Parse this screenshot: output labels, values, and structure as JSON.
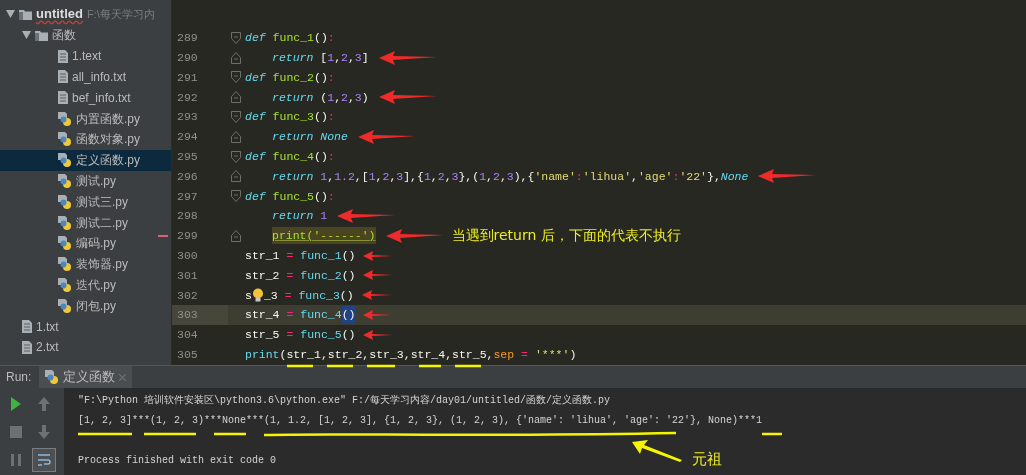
{
  "project_tree": {
    "name": "untitled",
    "path": "F:\\每天学习内",
    "expanded": true,
    "selected": false,
    "children": [
      {
        "name": "函数",
        "kind": "folder",
        "expanded": true,
        "selected": false,
        "children": [
          {
            "name": "1.text",
            "kind": "text",
            "selected": false
          },
          {
            "name": "all_info.txt",
            "kind": "text",
            "selected": false
          },
          {
            "name": "bef_info.txt",
            "kind": "text",
            "selected": false
          },
          {
            "name": "内置函数.py",
            "kind": "python",
            "selected": false
          },
          {
            "name": "函数对象.py",
            "kind": "python",
            "selected": false
          },
          {
            "name": "定义函数.py",
            "kind": "python",
            "selected": true
          },
          {
            "name": "测试.py",
            "kind": "python",
            "selected": false
          },
          {
            "name": "测试三.py",
            "kind": "python",
            "selected": false
          },
          {
            "name": "测试二.py",
            "kind": "python",
            "selected": false
          },
          {
            "name": "编码.py",
            "kind": "python",
            "selected": false
          },
          {
            "name": "装饰器.py",
            "kind": "python",
            "selected": false
          },
          {
            "name": "迭代.py",
            "kind": "python",
            "selected": false
          },
          {
            "name": "闭包.py",
            "kind": "python",
            "selected": false
          }
        ]
      },
      {
        "name": "1.txt",
        "kind": "text",
        "selected": false
      },
      {
        "name": "2.txt",
        "kind": "text",
        "selected": false
      }
    ]
  },
  "editor": {
    "lines": [
      {
        "number": "289",
        "fold": {
          "kind": "start"
        },
        "indented": false,
        "current": false,
        "tokens": [
          {
            "text": "def ",
            "kind": "kw"
          },
          {
            "text": "func_1",
            "kind": "fn"
          },
          {
            "text": "()",
            "kind": "p"
          },
          {
            "text": ":",
            "kind": "op"
          }
        ]
      },
      {
        "number": "290",
        "fold": {
          "kind": "end"
        },
        "indented": true,
        "arrow": {
          "kind": "large"
        },
        "current": false,
        "tokens": [
          {
            "text": "return ",
            "kind": "kw"
          },
          {
            "text": "[",
            "kind": "p"
          },
          {
            "text": "1",
            "kind": "num"
          },
          {
            "text": ",",
            "kind": "p"
          },
          {
            "text": "2",
            "kind": "num"
          },
          {
            "text": ",",
            "kind": "p"
          },
          {
            "text": "3",
            "kind": "num"
          },
          {
            "text": "]",
            "kind": "p"
          }
        ]
      },
      {
        "number": "291",
        "fold": {
          "kind": "start"
        },
        "indented": false,
        "current": false,
        "tokens": [
          {
            "text": "def ",
            "kind": "kw"
          },
          {
            "text": "func_2",
            "kind": "fn"
          },
          {
            "text": "()",
            "kind": "p"
          },
          {
            "text": ":",
            "kind": "op"
          }
        ]
      },
      {
        "number": "292",
        "fold": {
          "kind": "end"
        },
        "indented": true,
        "arrow": {
          "kind": "large"
        },
        "current": false,
        "tokens": [
          {
            "text": "return ",
            "kind": "kw"
          },
          {
            "text": "(",
            "kind": "p"
          },
          {
            "text": "1",
            "kind": "num"
          },
          {
            "text": ",",
            "kind": "p"
          },
          {
            "text": "2",
            "kind": "num"
          },
          {
            "text": ",",
            "kind": "p"
          },
          {
            "text": "3",
            "kind": "num"
          },
          {
            "text": ")",
            "kind": "p"
          }
        ]
      },
      {
        "number": "293",
        "fold": {
          "kind": "start"
        },
        "indented": false,
        "current": false,
        "tokens": [
          {
            "text": "def ",
            "kind": "kw"
          },
          {
            "text": "func_3",
            "kind": "fn"
          },
          {
            "text": "()",
            "kind": "p"
          },
          {
            "text": ":",
            "kind": "op"
          }
        ]
      },
      {
        "number": "294",
        "fold": {
          "kind": "end"
        },
        "indented": true,
        "arrow": {
          "kind": "large"
        },
        "current": false,
        "tokens": [
          {
            "text": "return ",
            "kind": "kw"
          },
          {
            "text": "None",
            "kind": "kw"
          }
        ]
      },
      {
        "number": "295",
        "fold": {
          "kind": "start"
        },
        "indented": false,
        "current": false,
        "tokens": [
          {
            "text": "def ",
            "kind": "kw"
          },
          {
            "text": "func_4",
            "kind": "fn"
          },
          {
            "text": "()",
            "kind": "p"
          },
          {
            "text": ":",
            "kind": "op"
          }
        ]
      },
      {
        "number": "296",
        "fold": {
          "kind": "end"
        },
        "indented": true,
        "arrow": {
          "kind": "large"
        },
        "current": false,
        "tokens": [
          {
            "text": "return ",
            "kind": "kw"
          },
          {
            "text": "1",
            "kind": "num"
          },
          {
            "text": ",",
            "kind": "p"
          },
          {
            "text": "1.2",
            "kind": "num"
          },
          {
            "text": ",[",
            "kind": "p"
          },
          {
            "text": "1",
            "kind": "num"
          },
          {
            "text": ",",
            "kind": "p"
          },
          {
            "text": "2",
            "kind": "num"
          },
          {
            "text": ",",
            "kind": "p"
          },
          {
            "text": "3",
            "kind": "num"
          },
          {
            "text": "],{",
            "kind": "p"
          },
          {
            "text": "1",
            "kind": "num"
          },
          {
            "text": ",",
            "kind": "p"
          },
          {
            "text": "2",
            "kind": "num"
          },
          {
            "text": ",",
            "kind": "p"
          },
          {
            "text": "3",
            "kind": "num"
          },
          {
            "text": "},(",
            "kind": "p"
          },
          {
            "text": "1",
            "kind": "num"
          },
          {
            "text": ",",
            "kind": "p"
          },
          {
            "text": "2",
            "kind": "num"
          },
          {
            "text": ",",
            "kind": "p"
          },
          {
            "text": "3",
            "kind": "num"
          },
          {
            "text": "),{",
            "kind": "p"
          },
          {
            "text": "'name'",
            "kind": "str"
          },
          {
            "text": ":",
            "kind": "op"
          },
          {
            "text": "'lihua'",
            "kind": "str"
          },
          {
            "text": ",",
            "kind": "p"
          },
          {
            "text": "'age'",
            "kind": "str"
          },
          {
            "text": ":",
            "kind": "op"
          },
          {
            "text": "'22'",
            "kind": "str"
          },
          {
            "text": "},",
            "kind": "p"
          },
          {
            "text": "None",
            "kind": "kw"
          }
        ]
      },
      {
        "number": "297",
        "fold": {
          "kind": "start"
        },
        "indented": false,
        "current": false,
        "tokens": [
          {
            "text": "def ",
            "kind": "kw"
          },
          {
            "text": "func_5",
            "kind": "fn"
          },
          {
            "text": "()",
            "kind": "p"
          },
          {
            "text": ":",
            "kind": "op"
          }
        ]
      },
      {
        "number": "298",
        "indented": true,
        "arrow": {
          "kind": "large"
        },
        "current": false,
        "tokens": [
          {
            "text": "return ",
            "kind": "kw"
          },
          {
            "text": "1",
            "kind": "num"
          }
        ]
      },
      {
        "number": "299",
        "fold": {
          "kind": "end"
        },
        "indented": true,
        "arrow": {
          "kind": "large"
        },
        "current": false,
        "marker": true,
        "note": "当遇到return 后，下面的代表不执行",
        "tokens": [
          {
            "text": "print('------')",
            "kind": "warn"
          }
        ]
      },
      {
        "number": "300",
        "indented": false,
        "arrow": {
          "kind": "small"
        },
        "current": false,
        "tokens": [
          {
            "text": "str_1 ",
            "kind": "p"
          },
          {
            "text": "= ",
            "kind": "op"
          },
          {
            "text": "func_1",
            "kind": "call"
          },
          {
            "text": "()",
            "kind": "p"
          }
        ]
      },
      {
        "number": "301",
        "indented": false,
        "arrow": {
          "kind": "small"
        },
        "current": false,
        "tokens": [
          {
            "text": "str_2 ",
            "kind": "p"
          },
          {
            "text": "= ",
            "kind": "op"
          },
          {
            "text": "func_2",
            "kind": "call"
          },
          {
            "text": "()",
            "kind": "p"
          }
        ]
      },
      {
        "number": "302",
        "indented": false,
        "arrow": {
          "kind": "small"
        },
        "current": false,
        "tokens": [
          {
            "text": "s",
            "kind": "p"
          },
          {
            "kind": "bulb"
          },
          {
            "text": "_3 ",
            "kind": "p"
          },
          {
            "text": "= ",
            "kind": "op"
          },
          {
            "text": "func_3",
            "kind": "call"
          },
          {
            "text": "()",
            "kind": "p"
          }
        ]
      },
      {
        "number": "303",
        "indented": false,
        "arrow": {
          "kind": "small"
        },
        "current": true,
        "tokens": [
          {
            "text": "str_4 ",
            "kind": "p"
          },
          {
            "text": "= ",
            "kind": "op"
          },
          {
            "text": "func_4",
            "kind": "call"
          },
          {
            "text": "()",
            "kind": "sel"
          }
        ]
      },
      {
        "number": "304",
        "indented": false,
        "arrow": {
          "kind": "small"
        },
        "current": false,
        "tokens": [
          {
            "text": "str_5 ",
            "kind": "p"
          },
          {
            "text": "= ",
            "kind": "op"
          },
          {
            "text": "func_5",
            "kind": "call"
          },
          {
            "text": "()",
            "kind": "p"
          }
        ]
      },
      {
        "number": "305",
        "indented": false,
        "current": false,
        "tokens": [
          {
            "text": "print",
            "kind": "call"
          },
          {
            "text": "(str_1,str_2,str_3,str_4,str_5,",
            "kind": "p"
          },
          {
            "text": "sep ",
            "kind": "param"
          },
          {
            "text": "= ",
            "kind": "op"
          },
          {
            "text": "'***'",
            "kind": "str"
          },
          {
            "text": ")",
            "kind": "p"
          }
        ]
      }
    ]
  },
  "run_panel": {
    "label": "Run:",
    "tab": {
      "title": "定义函数",
      "selected": true
    },
    "toolbar": [
      {
        "kind": "run",
        "disabled": false
      },
      {
        "kind": "up",
        "disabled": true
      },
      {
        "kind": "stop",
        "disabled": true
      },
      {
        "kind": "down",
        "disabled": true
      },
      {
        "kind": "pause",
        "disabled": true
      },
      {
        "kind": "wrap",
        "disabled": false,
        "selected": true
      }
    ],
    "console": [
      "\"F:\\Python 培训软件安装区\\python3.6\\python.exe\" F:/每天学习内容/day01/untitled/函数/定义函数.py",
      "[1, 2, 3]***(1, 2, 3)***None***(1, 1.2, [1, 2, 3], {1, 2, 3}, (1, 2, 3), {'name': 'lihua', 'age': '22'}, None)***1"
    ],
    "exit_message": "Process finished with exit code 0",
    "note": "元祖"
  }
}
